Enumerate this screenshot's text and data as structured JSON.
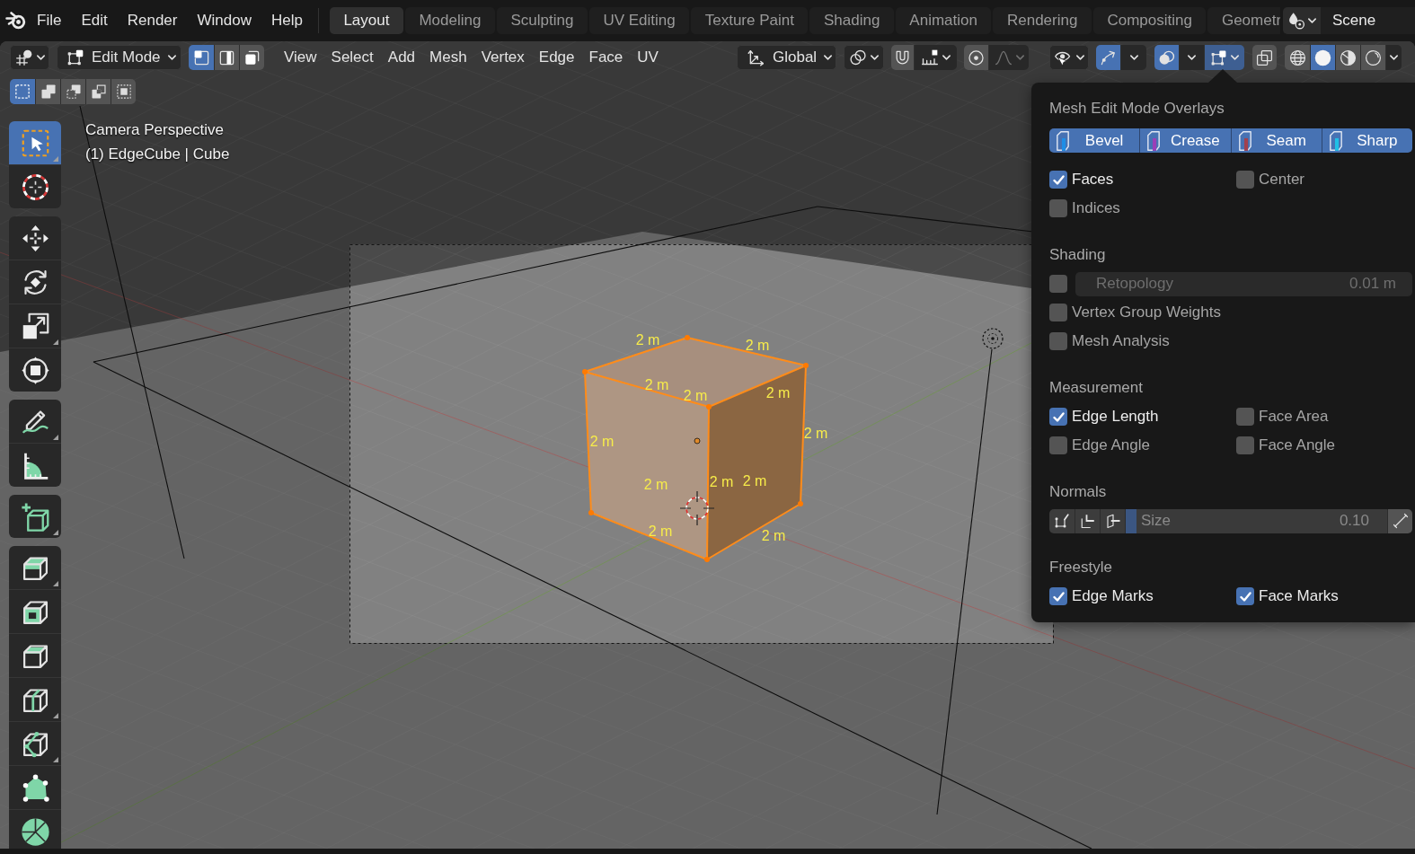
{
  "top_bar": {
    "menus": [
      "File",
      "Edit",
      "Render",
      "Window",
      "Help"
    ],
    "workspaces": [
      {
        "label": "Layout",
        "selected": true
      },
      {
        "label": "Modeling",
        "selected": false
      },
      {
        "label": "Sculpting",
        "selected": false
      },
      {
        "label": "UV Editing",
        "selected": false
      },
      {
        "label": "Texture Paint",
        "selected": false
      },
      {
        "label": "Shading",
        "selected": false
      },
      {
        "label": "Animation",
        "selected": false
      },
      {
        "label": "Rendering",
        "selected": false
      },
      {
        "label": "Compositing",
        "selected": false
      },
      {
        "label": "Geometr",
        "selected": false
      }
    ],
    "scene": "Scene"
  },
  "header": {
    "mode": "Edit Mode",
    "select_modes": [
      {
        "kind": "vertex",
        "selected": true
      },
      {
        "kind": "edge",
        "selected": false
      },
      {
        "kind": "face",
        "selected": false
      }
    ],
    "menus": [
      "View",
      "Select",
      "Add",
      "Mesh",
      "Vertex",
      "Edge",
      "Face",
      "UV"
    ],
    "orientation": "Global",
    "snap": {
      "on": false
    },
    "proportional_editing": {
      "on": false
    },
    "gizmos": {
      "on": true
    },
    "overlays": {
      "on": true
    },
    "mesh_overlays": {
      "expanded": true
    },
    "xray": {
      "on": false
    },
    "shading": [
      {
        "kind": "wireframe",
        "selected": false
      },
      {
        "kind": "solid",
        "selected": true
      },
      {
        "kind": "material",
        "selected": false
      },
      {
        "kind": "rendered",
        "selected": false
      }
    ],
    "box_select_modes": [
      {
        "kind": "new",
        "selected": true
      },
      {
        "kind": "extend",
        "selected": false
      },
      {
        "kind": "subtract",
        "selected": false
      },
      {
        "kind": "invert",
        "selected": false
      },
      {
        "kind": "intersect",
        "selected": false
      }
    ]
  },
  "toolbar": {
    "groups": [
      {
        "tools": [
          {
            "kind": "select_box",
            "selected": true
          },
          {
            "kind": "cursor",
            "selected": false
          }
        ]
      },
      {
        "tools": [
          {
            "kind": "move",
            "selected": false
          },
          {
            "kind": "rotate",
            "selected": false
          },
          {
            "kind": "scale",
            "selected": false
          },
          {
            "kind": "transform",
            "selected": false
          }
        ]
      },
      {
        "tools": [
          {
            "kind": "annotate",
            "selected": false
          },
          {
            "kind": "measure",
            "selected": false
          }
        ]
      },
      {
        "tools": [
          {
            "kind": "add_cube",
            "selected": false
          }
        ]
      },
      {
        "tools": [
          {
            "kind": "extrude",
            "selected": false
          },
          {
            "kind": "inset",
            "selected": false
          },
          {
            "kind": "bevel",
            "selected": false
          },
          {
            "kind": "loop_cut",
            "selected": false
          },
          {
            "kind": "knife",
            "selected": false
          },
          {
            "kind": "poly_build",
            "selected": false
          },
          {
            "kind": "spin",
            "selected": false
          }
        ]
      }
    ]
  },
  "viewport": {
    "info": [
      "Camera Perspective",
      "(1) EdgeCube | Cube"
    ],
    "edge_labels": [
      "2 m",
      "2 m",
      "2 m",
      "2 m",
      "2 m",
      "2 m",
      "2 m",
      "2 m",
      "2 m",
      "2 m",
      "2 m",
      "2 m"
    ]
  },
  "overlay_popover": {
    "title": "Mesh Edit Mode Overlays",
    "edge_marks": [
      {
        "label": "Bevel",
        "on": true,
        "color": "#1e8ee6"
      },
      {
        "label": "Crease",
        "on": true,
        "color": "#9a3fb8"
      },
      {
        "label": "Seam",
        "on": true,
        "color": "#a2404e"
      },
      {
        "label": "Sharp",
        "on": true,
        "color": "#20c0e6"
      }
    ],
    "sections": [
      {
        "kind": "grid",
        "checkboxes": [
          {
            "label": "Faces",
            "checked": true
          },
          {
            "label": "Center",
            "checked": false
          },
          {
            "label": "Indices",
            "checked": false
          }
        ]
      },
      {
        "kind": "shading",
        "heading": "Shading",
        "retopology": {
          "checked": false,
          "label": "Retopology",
          "value": "0.01 m",
          "disabled": true
        },
        "checkboxes": [
          {
            "label": "Vertex Group Weights",
            "checked": false
          },
          {
            "label": "Mesh Analysis",
            "checked": false
          }
        ]
      },
      {
        "kind": "grid",
        "heading": "Measurement",
        "checkboxes": [
          {
            "label": "Edge Length",
            "checked": true
          },
          {
            "label": "Face Area",
            "checked": false
          },
          {
            "label": "Edge Angle",
            "checked": false
          },
          {
            "label": "Face Angle",
            "checked": false
          }
        ]
      },
      {
        "kind": "normals",
        "heading": "Normals",
        "buttons": [
          {
            "kind": "vertex"
          },
          {
            "kind": "split"
          },
          {
            "kind": "face"
          }
        ],
        "size": {
          "label": "Size",
          "value": "0.10",
          "level": 0.04,
          "disabled": true
        }
      },
      {
        "kind": "grid",
        "heading": "Freestyle",
        "checkboxes": [
          {
            "label": "Edge Marks",
            "checked": true
          },
          {
            "label": "Face Marks",
            "checked": true
          }
        ]
      }
    ]
  }
}
